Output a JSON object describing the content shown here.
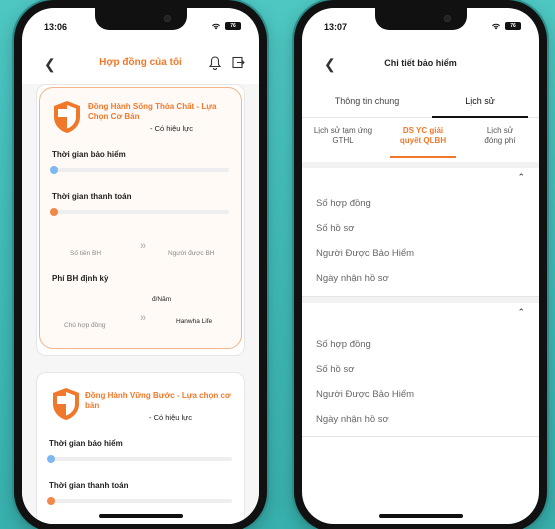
{
  "left_phone": {
    "status_time": "13:06",
    "battery": "76",
    "title": "Hợp đồng của tôi",
    "cards": [
      {
        "product_name": "Đồng Hành Sống Thỏa Chất - Lựa Chọn Cơ Bản",
        "status": "- Có hiệu lực",
        "insurance_period_label": "Thời gian bảo hiểm",
        "payment_period_label": "Thời gian thanh toán",
        "sum_insured_label": "Số tiền BH",
        "insured_person_label": "Người được BH",
        "periodic_premium_label": "Phí BH định kỳ",
        "premium_value": "đ/Năm",
        "policy_owner_label": "Chủ hợp đồng",
        "policy_owner_value": "Hanwha Life"
      },
      {
        "product_name": "Đồng Hành Vững Bước - Lựa chọn cơ bản",
        "status": "- Có hiệu lực",
        "insurance_period_label": "Thời gian bảo hiểm",
        "payment_period_label": "Thời gian thanh toán"
      }
    ],
    "colors": {
      "accent": "#f0782a",
      "insurance_dot": "#7db8f0",
      "payment_dot": "#f0884a"
    }
  },
  "right_phone": {
    "status_time": "13:07",
    "battery": "76",
    "title": "Chi tiết bảo hiểm",
    "tabs": [
      {
        "label": "Thông tin chung",
        "active": false
      },
      {
        "label": "Lịch sử",
        "active": true
      }
    ],
    "subtabs": [
      {
        "label_line1": "Lịch sử tạm ứng",
        "label_line2": "GTHL",
        "active": false
      },
      {
        "label_line1": "DS YC giải",
        "label_line2": "quyết QLBH",
        "active": true
      },
      {
        "label_line1": "Lịch sử",
        "label_line2": "đóng phí",
        "active": false
      }
    ],
    "sections": [
      {
        "fields": [
          "Số hợp đồng",
          "Số hồ sơ",
          "Người Được Bảo Hiểm",
          "Ngày nhận hồ sơ"
        ]
      },
      {
        "fields": [
          "Số hợp đồng",
          "Số hồ sơ",
          "Người Được Bảo Hiểm",
          "Ngày nhận hồ sơ"
        ]
      }
    ]
  }
}
